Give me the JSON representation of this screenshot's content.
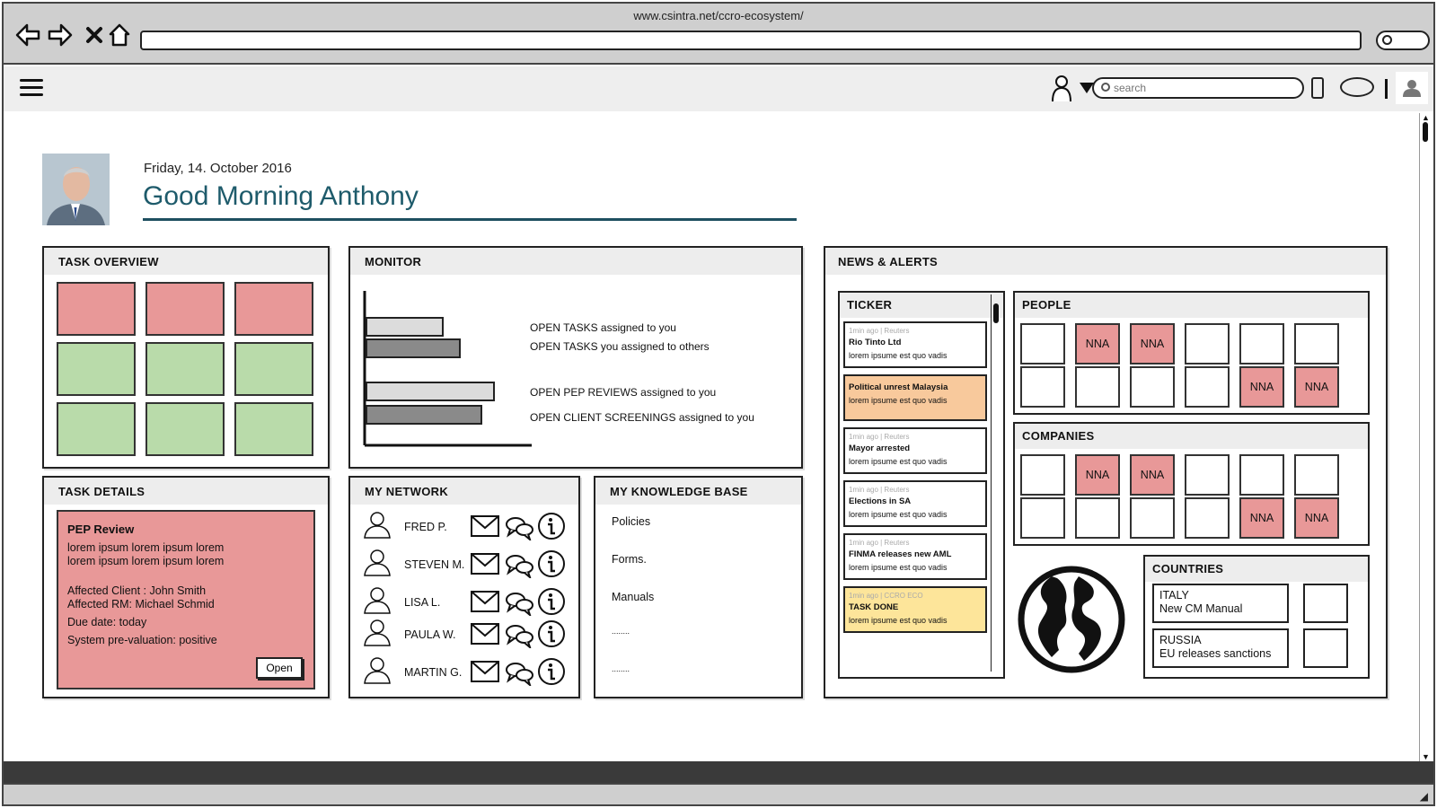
{
  "browser": {
    "url": "www.csintra.net/ccro-ecosystem/",
    "search_label": ""
  },
  "appbar": {
    "search_placeholder": "search"
  },
  "header": {
    "date": "Friday, 14. October 2016",
    "greeting": "Good Morning Anthony"
  },
  "colors": {
    "red": "#e89898",
    "green": "#b9dbaa",
    "orange": "#f8c99c",
    "yellow": "#fde59a",
    "teal": "#1e5b6b"
  },
  "task_overview": {
    "title": "TASK OVERVIEW",
    "tiles": [
      "red",
      "red",
      "red",
      "green",
      "green",
      "green",
      "green",
      "green",
      "green"
    ]
  },
  "monitor": {
    "title": "MONITOR",
    "labels": [
      "OPEN TASKS assigned to you",
      "OPEN TASKS you assigned to others",
      "OPEN PEP REVIEWS assigned to you",
      "OPEN CLIENT SCREENINGS assigned to you"
    ],
    "bar_levels": [
      0.47,
      0.58,
      0.79,
      0.71
    ]
  },
  "task_details": {
    "title": "TASK DETAILS",
    "card_title": "PEP Review",
    "line1": "lorem ipsum lorem ipsum lorem",
    "line2": "lorem ipsum lorem ipsum lorem",
    "client": "Affected Client : John Smith",
    "rm": "Affected RM: Michael Schmid",
    "due": "Due date: today",
    "valuation": "System pre-valuation: positive",
    "open_label": "Open"
  },
  "network": {
    "title": "MY NETWORK",
    "people": [
      "FRED P.",
      "STEVEN M.",
      "LISA L.",
      "PAULA W.",
      "MARTIN G."
    ]
  },
  "knowledge": {
    "title": "MY KNOWLEDGE BASE",
    "items": [
      "Policies",
      "Forms.",
      "Manuals",
      "........",
      "........"
    ]
  },
  "news": {
    "title": "NEWS & ALERTS",
    "ticker_title": "TICKER",
    "ticker": [
      {
        "meta": "1min ago | Reuters",
        "head": "Rio Tinto Ltd",
        "body": "lorem ipsume est quo vadis",
        "color": "#ffffff"
      },
      {
        "meta": "",
        "head": "Political unrest Malaysia",
        "body": "lorem ipsume est quo vadis",
        "color": "#f8c99c"
      },
      {
        "meta": "1min ago | Reuters",
        "head": "Mayor arrested",
        "body": "lorem ipsume est quo vadis",
        "color": "#ffffff"
      },
      {
        "meta": "1min ago | Reuters",
        "head": "Elections in SA",
        "body": "lorem ipsume est quo vadis",
        "color": "#ffffff"
      },
      {
        "meta": "1min ago | Reuters",
        "head": "FINMA releases new AML",
        "body": "lorem ipsume est quo vadis",
        "color": "#ffffff"
      },
      {
        "meta": "1min ago | CCRO ECO",
        "head": "TASK DONE",
        "body": "lorem ipsume est quo vadis",
        "color": "#fde59a"
      }
    ],
    "people_title": "PEOPLE",
    "people_grid": [
      "",
      "NNA",
      "NNA",
      "",
      "",
      "",
      "",
      "",
      "",
      "",
      "NNA",
      "NNA"
    ],
    "companies_title": "COMPANIES",
    "companies_grid": [
      "",
      "NNA",
      "NNA",
      "",
      "",
      "",
      "",
      "",
      "",
      "",
      "NNA",
      "NNA"
    ],
    "countries_title": "COUNTRIES",
    "countries": [
      {
        "name": "ITALY",
        "note": "New CM Manual"
      },
      {
        "name": "RUSSIA",
        "note": "EU releases sanctions"
      }
    ]
  }
}
